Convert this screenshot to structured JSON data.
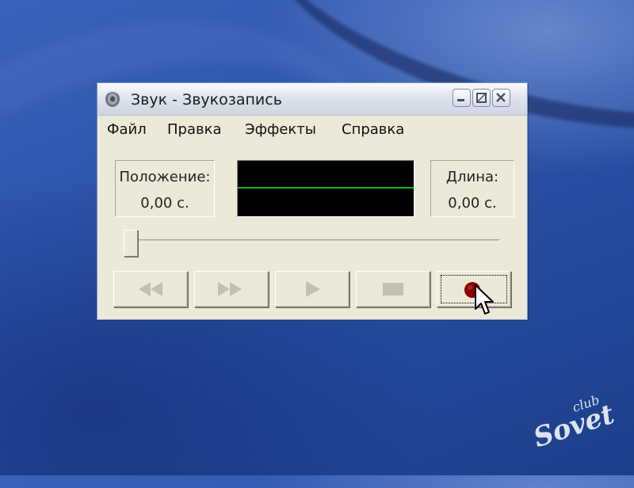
{
  "window": {
    "title": "Звук - Звукозапись",
    "app_icon": "speaker-icon",
    "controls": [
      "minimize-icon",
      "maximize-icon",
      "close-icon"
    ]
  },
  "menu": {
    "items": [
      "Файл",
      "Правка",
      "Эффекты",
      "Справка"
    ]
  },
  "position": {
    "label": "Положение:",
    "value": "0,00 с."
  },
  "length": {
    "label": "Длина:",
    "value": "0,00 с."
  },
  "waveform": {
    "background": "#000000",
    "line_color": "#11b311"
  },
  "seek": {
    "fraction": 0
  },
  "transport": {
    "buttons": [
      {
        "icon": "rewind-icon",
        "enabled": false
      },
      {
        "icon": "fast-forward-icon",
        "enabled": false
      },
      {
        "icon": "play-icon",
        "enabled": false
      },
      {
        "icon": "stop-icon",
        "enabled": false
      },
      {
        "icon": "record-icon",
        "enabled": true,
        "focused": true,
        "color": "#8b0000"
      }
    ]
  },
  "watermark": {
    "small": "club",
    "large": "Sovet"
  }
}
